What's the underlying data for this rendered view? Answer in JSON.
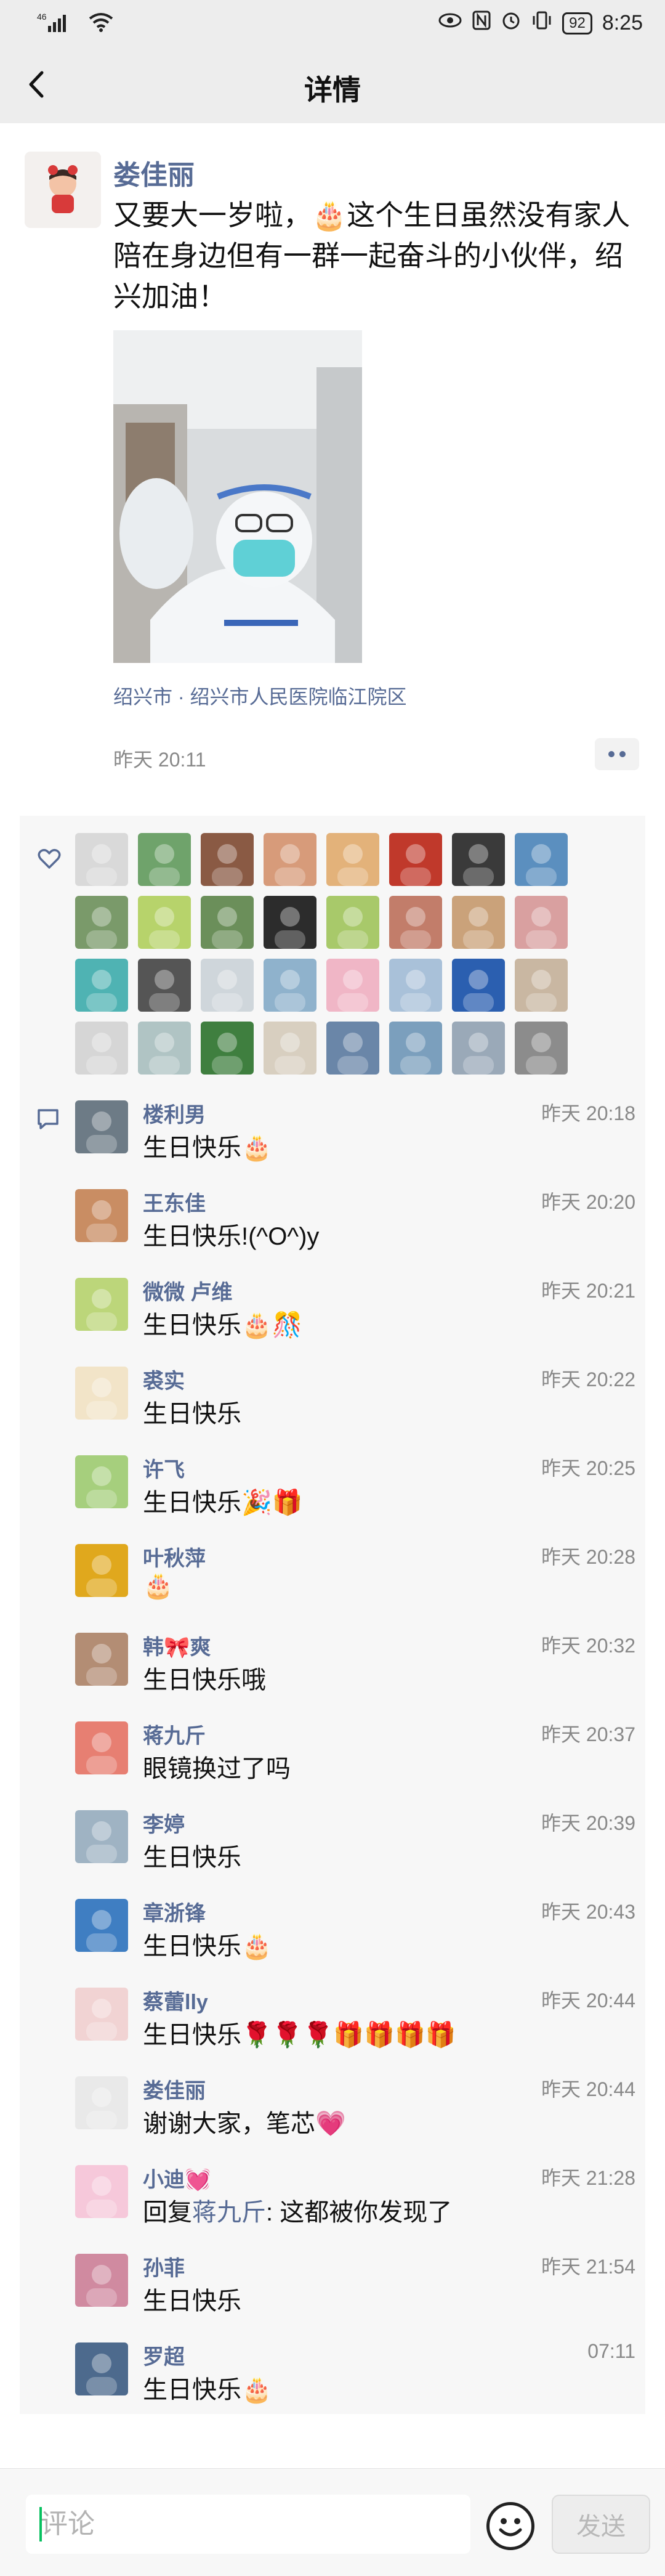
{
  "status_bar": {
    "signal": "⁴⁶ᴵ",
    "wifi": "wifi",
    "battery": "92",
    "time": "8:25",
    "icons": [
      "eye-icon",
      "nfc-icon",
      "alarm-icon",
      "vibrate-icon"
    ]
  },
  "header": {
    "title": "详情"
  },
  "post": {
    "author": "娄佳丽",
    "text": "又要大一岁啦，🎂这个生日虽然没有家人陪在身边但有一群一起奋斗的小伙伴，绍兴加油！",
    "location": "绍兴市 · 绍兴市人民医院临江院区",
    "time": "昨天 20:11"
  },
  "likes": {
    "avatars": [
      "#d9d9d9",
      "#6fa36b",
      "#8a5a44",
      "#d79b7a",
      "#e3b27a",
      "#c0392b",
      "#3a3a3a",
      "#5b8fbf",
      "#7a9a6a",
      "#b7d36b",
      "#6b8f5a",
      "#2c2c2c",
      "#a8c96a",
      "#c27d6a",
      "#caa27a",
      "#d9a0a0",
      "#4fb3b3",
      "#555555",
      "#cfd6db",
      "#8fb2cc",
      "#f0b6c6",
      "#a9c1d9",
      "#2b5fb0",
      "#c9b7a2",
      "#d6d6d6",
      "#b0c4c4",
      "#3f7f3f",
      "#d8cfc0",
      "#6a86a8",
      "#7b9fbd",
      "#9aa9b8",
      "#8c8c8c"
    ]
  },
  "comments": [
    {
      "name": "楼利男",
      "time": "昨天 20:18",
      "text": "生日快乐🎂",
      "avatar_color": "#6d7b86"
    },
    {
      "name": "王东佳",
      "time": "昨天 20:20",
      "text": "生日快乐!(^O^)y",
      "avatar_color": "#c98d63"
    },
    {
      "name": "微微 卢维",
      "time": "昨天 20:21",
      "text": "生日快乐🎂🎊",
      "avatar_color": "#bcd67a"
    },
    {
      "name": "裘实",
      "time": "昨天 20:22",
      "text": "生日快乐",
      "avatar_color": "#f2e4c8"
    },
    {
      "name": "许飞",
      "time": "昨天 20:25",
      "text": "生日快乐🎉🎁",
      "avatar_color": "#a6cf7d"
    },
    {
      "name": "叶秋萍",
      "time": "昨天 20:28",
      "text": "🎂",
      "avatar_color": "#e0a81d"
    },
    {
      "name": "韩🎀爽",
      "time": "昨天 20:32",
      "text": "生日快乐哦",
      "avatar_color": "#b38d74"
    },
    {
      "name": "蒋九斤",
      "time": "昨天 20:37",
      "text": "眼镜换过了吗",
      "avatar_color": "#e77f72"
    },
    {
      "name": "李婷",
      "time": "昨天 20:39",
      "text": "生日快乐",
      "avatar_color": "#9fb3c3"
    },
    {
      "name": "章浙锋",
      "time": "昨天 20:43",
      "text": "生日快乐🎂",
      "avatar_color": "#3f7ec2"
    },
    {
      "name": "蔡蕾lly",
      "time": "昨天 20:44",
      "text": "生日快乐🌹🌹🌹🎁🎁🎁🎁",
      "avatar_color": "#f1d3d3"
    },
    {
      "name": "娄佳丽",
      "time": "昨天 20:44",
      "text": "谢谢大家，笔芯💗",
      "avatar_color": "#e9e9e9"
    },
    {
      "name": "小迪💓",
      "time": "昨天 21:28",
      "reply_word": "回复",
      "reply_to": "蒋九斤",
      "reply_rest": ": 这都被你发现了",
      "text": "",
      "avatar_color": "#f6c8da"
    },
    {
      "name": "孙菲",
      "time": "昨天 21:54",
      "text": "生日快乐",
      "avatar_color": "#d08aa0"
    },
    {
      "name": "罗超",
      "time": "07:11",
      "text": "生日快乐🎂",
      "avatar_color": "#4d6a8d"
    }
  ],
  "input": {
    "placeholder": "评论",
    "send_label": "发送"
  }
}
